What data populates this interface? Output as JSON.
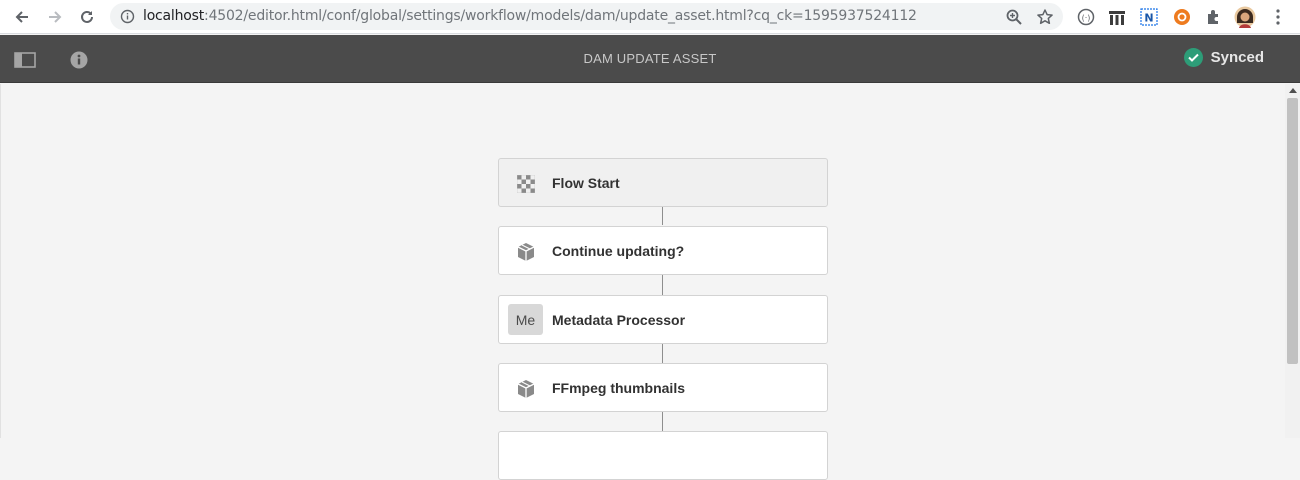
{
  "browser": {
    "url_host": "localhost",
    "url_path": ":4502/editor.html/conf/global/settings/workflow/models/dam/update_asset.html?cq_ck=1595937524112"
  },
  "header": {
    "title": "DAM UPDATE ASSET",
    "status": "Synced",
    "status_color": "#2d9d78"
  },
  "workflow": {
    "steps": [
      {
        "label": "Flow Start",
        "icon": "flow-start-icon"
      },
      {
        "label": "Continue updating?",
        "icon": "cube-icon"
      },
      {
        "label": "Metadata Processor",
        "icon": "initials-badge",
        "badge": "Me"
      },
      {
        "label": "FFmpeg thumbnails",
        "icon": "cube-icon"
      }
    ]
  }
}
